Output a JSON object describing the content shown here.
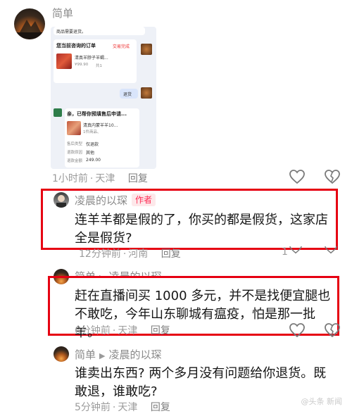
{
  "comments": [
    {
      "username": "简单",
      "time": "1小时前",
      "location": "天津",
      "reply_label": "回复",
      "chat_screenshot": {
        "top_text": "商品需要退货。",
        "order_title": "您当前咨询的订单",
        "order_status": "交易完成",
        "product_name": "清真羊脖子羊蝎...",
        "product_price": "¥99.90",
        "product_qty": "共1",
        "user_msg": "退货",
        "service_msg": "亲，已帮你预填售后申请...",
        "product2_name": "清真内蒙羊羊10...",
        "product2_sub": "1件商品、",
        "rows": [
          {
            "label": "售后类型",
            "value": "仅退款"
          },
          {
            "label": "退款原因",
            "value": "其他"
          },
          {
            "label": "退款金额",
            "value": "249.00"
          }
        ]
      }
    },
    {
      "username": "凌晨的以琛",
      "author_tag": "作者",
      "text": "连羊羊都是假的了，你买的都是假货，这家店全是假货?",
      "time": "12分钟前",
      "location": "河南",
      "reply_label": "回复",
      "like_count": "1"
    },
    {
      "username": "简单",
      "reply_to": "凌晨的以琛",
      "text": "赶在直播间买 1000 多元，并不是找便宜腿也不敢吃，今年山东聊城有瘟疫，怕是那一批羊。",
      "time": "6分钟前",
      "location": "天津",
      "reply_label": "回复"
    },
    {
      "username": "简单",
      "reply_to": "凌晨的以琛",
      "text": "谁卖出东西? 两个多月没有问题给你退货。既敢退，谁敢吃?",
      "time": "5分钟前",
      "location": "天津",
      "reply_label": "回复"
    }
  ],
  "watermark": "@头条 新闻",
  "colors": {
    "highlight_border": "#e60012",
    "author_tag_bg": "#fde8ea",
    "author_tag_text": "#fe2c55",
    "meta_text": "#9b9b9b"
  },
  "icons": [
    "avatar",
    "heart-icon",
    "broken-heart-icon",
    "reply-arrow-icon"
  ]
}
